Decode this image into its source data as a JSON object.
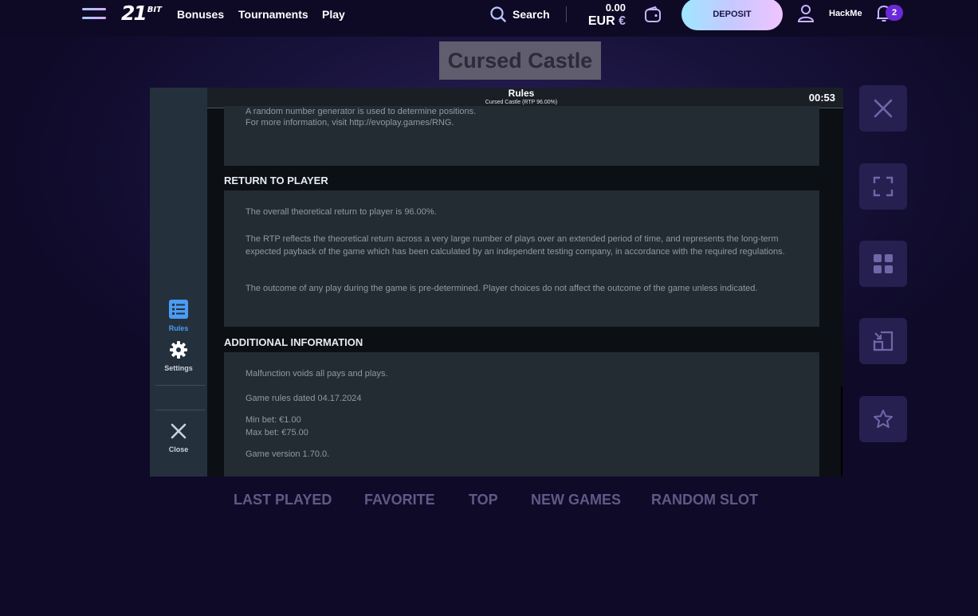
{
  "header": {
    "logo_number": "21",
    "logo_suffix": "BIT",
    "nav": [
      "Bonuses",
      "Tournaments",
      "Play"
    ],
    "search_label": "Search",
    "balance_amount": "0.00",
    "balance_currency": "EUR",
    "balance_symbol": "€",
    "deposit_label": "DEPOSIT",
    "username": "HackMe",
    "notifications_count": "2"
  },
  "game": {
    "title": "Cursed Castle",
    "rules_title": "Rules",
    "rules_subtitle": "Cursed Castle (RTP 96.00%)",
    "timer": "00:53",
    "sidebar": {
      "rules": "Rules",
      "settings": "Settings",
      "close": "Close"
    },
    "rng_lines": [
      "A random number generator is used to determine positions.",
      "For more information, visit http://evoplay.games/RNG."
    ],
    "rtp_heading": "RETURN TO PLAYER",
    "rtp_paragraphs": [
      "The overall theoretical return to player is 96.00%.",
      "The RTP reflects the theoretical return across a very large number of plays over an extended period of time, and represents the long-term expected payback of the game which has been calculated by an independent testing company, in accordance with the required regulations.",
      "The outcome of any play during the game is pre-determined. Player choices do not affect the outcome of the game unless indicated."
    ],
    "info_heading": "ADDITIONAL INFORMATION",
    "info_lines": [
      "Malfunction voids all pays and plays.",
      "Game rules dated 04.17.2024",
      "Min bet: €1.00",
      "Max bet: €75.00",
      "Game version 1.70.0."
    ]
  },
  "right_actions": [
    "close-icon",
    "fullscreen-icon",
    "grid-icon",
    "picture-in-picture-icon",
    "star-icon"
  ],
  "bottom_tabs": [
    "LAST PLAYED",
    "FAVORITE",
    "TOP",
    "NEW GAMES",
    "RANDOM SLOT"
  ],
  "colors": {
    "background": "#0f0a28",
    "accent_purple": "#6a2ad8",
    "deposit_gradient_start": "#9fe6ff",
    "deposit_gradient_end": "#f0c4ff",
    "rules_active": "#4a9cf5"
  }
}
